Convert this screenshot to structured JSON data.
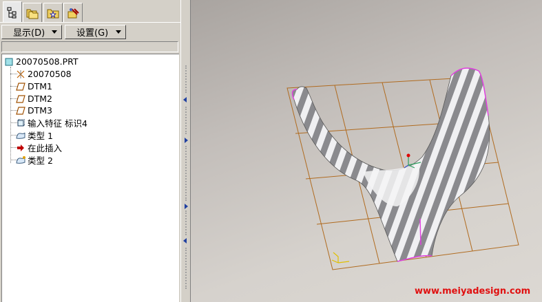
{
  "tabs": [
    {
      "icon": "model-tree-icon",
      "active": true
    },
    {
      "icon": "folder-browser-icon",
      "active": false
    },
    {
      "icon": "favorites-icon",
      "active": false
    },
    {
      "icon": "connections-icon",
      "active": false
    }
  ],
  "menus": {
    "display_label": "显示(D)",
    "settings_label": "设置(G)"
  },
  "tree": {
    "root_label": "20070508.PRT",
    "items": [
      {
        "label": "20070508",
        "icon": "coordinate-system-icon"
      },
      {
        "label": "DTM1",
        "icon": "datum-plane-icon"
      },
      {
        "label": "DTM2",
        "icon": "datum-plane-icon"
      },
      {
        "label": "DTM3",
        "icon": "datum-plane-icon"
      },
      {
        "label": "输入特征 标识4",
        "icon": "import-feature-icon"
      },
      {
        "label": "类型 1",
        "icon": "surface-feature-icon"
      },
      {
        "label": "在此插入",
        "icon": "insert-here-arrow-icon"
      },
      {
        "label": "类型 2",
        "icon": "surface-feature-icon"
      }
    ]
  },
  "watermark": "www.meiyadesign.com",
  "colors": {
    "panel_bg": "#d4d0c8",
    "grid": "#b06a1e",
    "edge_highlight": "#e040e0",
    "watermark": "#e01010",
    "insert_arrow": "#c00000"
  }
}
